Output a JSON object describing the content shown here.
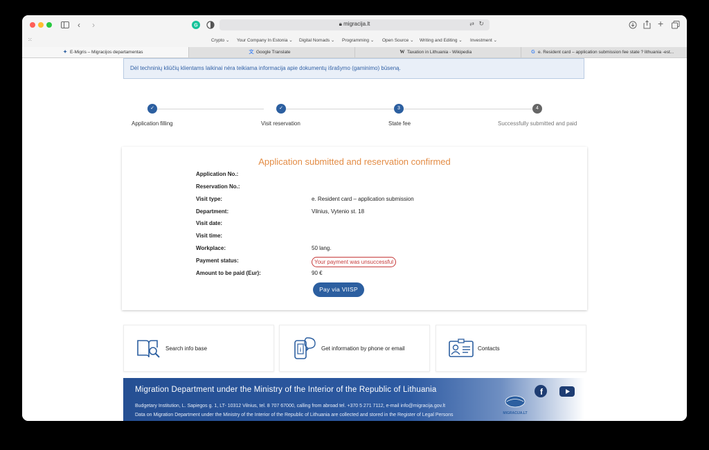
{
  "browser": {
    "url": "migracija.lt",
    "favorites": [
      "Crypto ⌄",
      "Your Company In Estonia ⌄",
      "Digital Nomads ⌄",
      "Programming ⌄",
      "Open Source ⌄",
      "Writing and Editing ⌄",
      "Investment ⌄"
    ],
    "tabs": [
      {
        "label": "E-Migris – Migracijos departamentas",
        "icon": "emigris-favicon"
      },
      {
        "label": "Google Translate",
        "icon": "translate-favicon"
      },
      {
        "label": "Taxation in Lithuania - Wikipedia",
        "icon": "W"
      },
      {
        "label": "e. Resident card – application submission fee state ? lithuania -est...",
        "icon": "G"
      }
    ]
  },
  "notice": "Dėl techninių kliūčių klientams laikinai nėra teikiama informacija apie dokumentų išrašymo (gaminimo) būseną.",
  "steps": [
    {
      "label": "Application filling",
      "mark": "✓",
      "state": "done"
    },
    {
      "label": "Visit reservation",
      "mark": "✓",
      "state": "done"
    },
    {
      "label": "State fee",
      "mark": "3",
      "state": "current"
    },
    {
      "label": "Successfully submitted and paid",
      "mark": "4",
      "state": "pending"
    }
  ],
  "card": {
    "title": "Application submitted and reservation confirmed",
    "rows": [
      {
        "label": "Application No.:",
        "value": ""
      },
      {
        "label": "Reservation No.:",
        "value": ""
      },
      {
        "label": "Visit type:",
        "value": "e. Resident card – application submission"
      },
      {
        "label": "Department:",
        "value": "Vilnius, Vytenio st. 18"
      },
      {
        "label": "Visit date:",
        "value": ""
      },
      {
        "label": "Visit time:",
        "value": ""
      },
      {
        "label": "Workplace:",
        "value": "50 lang."
      },
      {
        "label": "Payment status:",
        "value": "Your payment was unsuccessful"
      },
      {
        "label": "Amount to be paid (Eur):",
        "value": "90 €"
      }
    ],
    "pay_button": "Pay via VIISP"
  },
  "info_cards": [
    {
      "label": "Search info base",
      "icon": "book-search-icon"
    },
    {
      "label": "Get information by phone or email",
      "icon": "phone-info-icon"
    },
    {
      "label": "Contacts",
      "icon": "contacts-card-icon"
    }
  ],
  "footer": {
    "title": "Migration Department under the Ministry of the Interior of the Republic of Lithuania",
    "line1": "Budgetary Institution, L. Sapiegos g. 1, LT- 10312 Vilnius, tel. 8 707 67000, calling from abroad tel. +370 5 271 7112, e-mail info@migracija.gov.lt",
    "line2": "Data on Migration Department under the Ministry of the Interior of the Republic of Lithuania are collected and stored in the Register of Legal Persons",
    "logo_text": "MIGRACIJA.LT"
  },
  "colors": {
    "primary": "#2c5fa0",
    "accent_orange": "#e38c45",
    "error_red": "#c63b3b",
    "step_pending": "#666666"
  }
}
